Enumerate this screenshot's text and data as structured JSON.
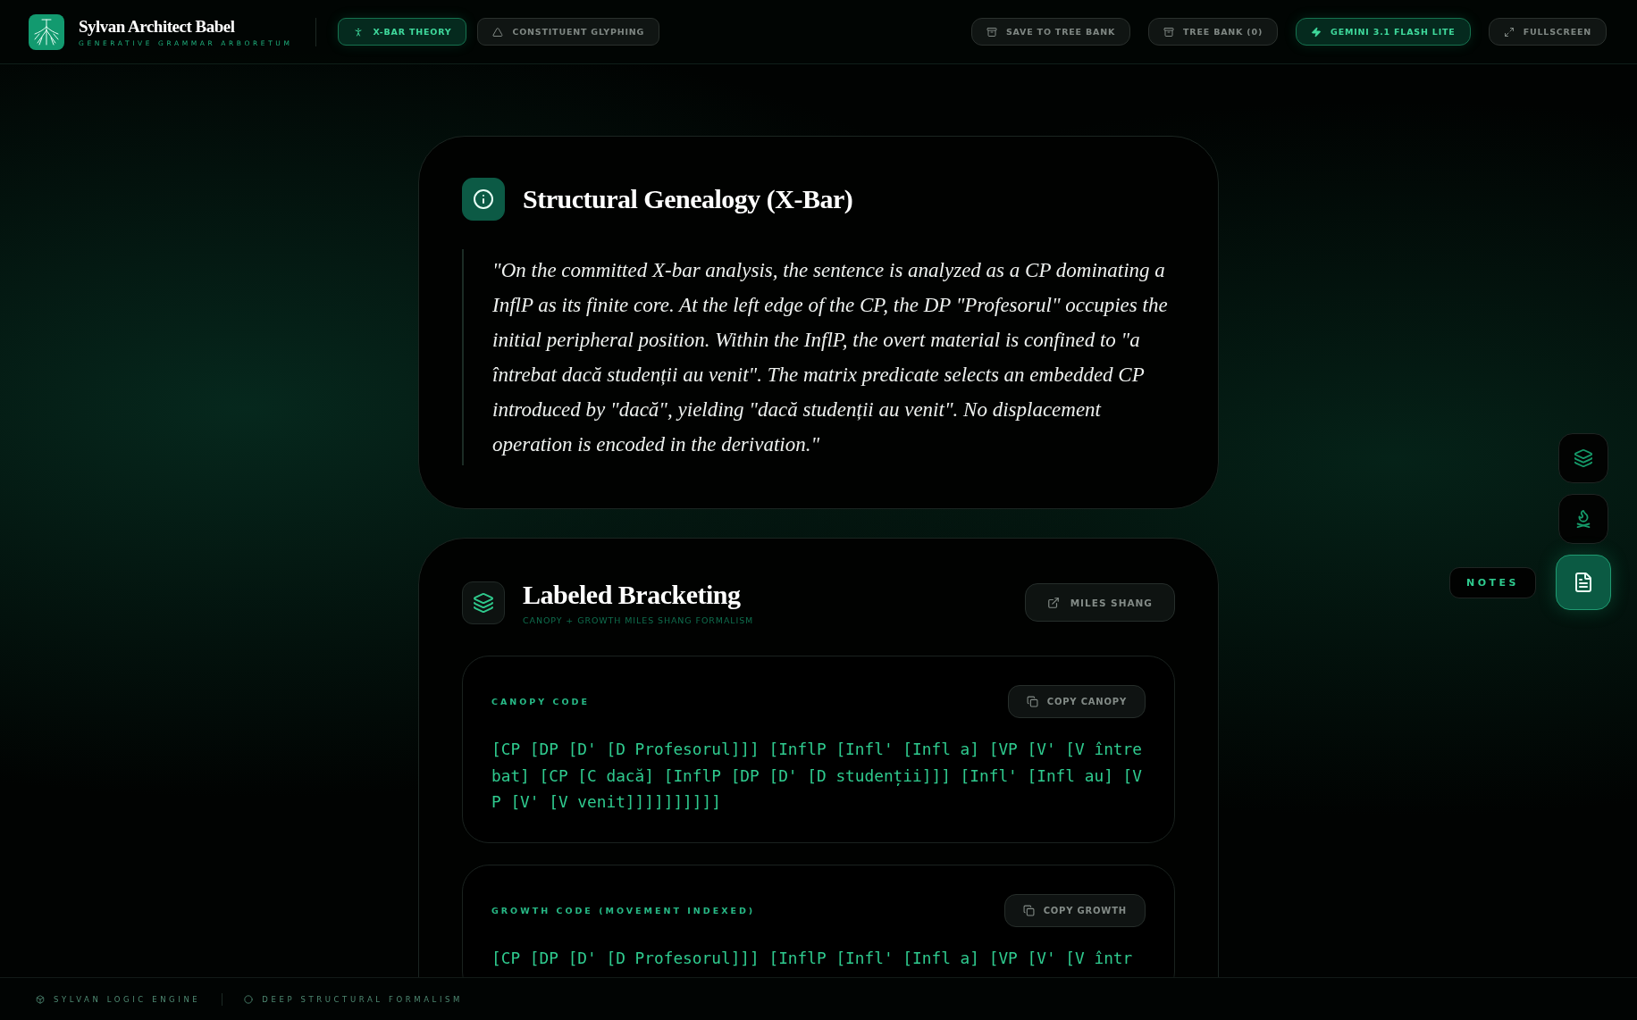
{
  "header": {
    "brand": {
      "title": "Sylvan Architect Babel",
      "subtitle": "GENERATIVE GRAMMAR ARBORETUM"
    },
    "mode_tabs": [
      {
        "label": "X-BAR THEORY",
        "kind": "figure",
        "selected": true
      },
      {
        "label": "CONSTITUENT GLYPHING",
        "kind": "triangle",
        "selected": false
      }
    ],
    "actions": [
      {
        "label": "SAVE TO TREE BANK",
        "kind": "archive",
        "highlighted": false
      },
      {
        "label": "TREE BANK (0)",
        "kind": "archive",
        "highlighted": false
      },
      {
        "label": "GEMINI 3.1 FLASH LITE",
        "kind": "bolt",
        "highlighted": true
      },
      {
        "label": "FULLSCREEN",
        "kind": "expand",
        "highlighted": false
      }
    ]
  },
  "genealogy_card": {
    "title": "Structural Genealogy (X-Bar)",
    "quote": "\"On the committed X-bar analysis, the sentence is analyzed as a CP dominating a InflP as its finite core. At the left edge of the CP, the DP \"Profesorul\" occupies the initial peripheral position. Within the InflP, the overt material is confined to \"a întrebat dacă studenții au venit\". The matrix predicate selects an embedded CP introduced by \"dacă\", yielding \"dacă studenții au venit\". No displacement operation is encoded in the derivation.\""
  },
  "bracketing_card": {
    "title": "Labeled Bracketing",
    "subtitle": "CANOPY + GROWTH MILES SHANG FORMALISM",
    "link_button": "MILES SHANG",
    "code_blocks": [
      {
        "label": "CANOPY CODE",
        "button": "COPY CANOPY",
        "code": "[CP [DP [D' [D Profesorul]]] [InflP [Infl' [Infl a] [VP [V' [V întrebat] [CP [C dacă] [InflP [DP [D' [D studenții]]] [Infl' [Infl au] [VP [V' [V venit]]]]]]]]]]"
      },
      {
        "label": "GROWTH CODE (MOVEMENT INDEXED)",
        "button": "COPY GROWTH",
        "code": "[CP [DP [D' [D Profesorul]]] [InflP [Infl' [Infl a] [VP [V' [V într"
      }
    ]
  },
  "side_rail": {
    "items": [
      {
        "kind": "layers",
        "selected": false
      },
      {
        "kind": "campfire",
        "selected": false
      },
      {
        "kind": "notes",
        "selected": true
      }
    ],
    "tooltip": "NOTES"
  },
  "footer": {
    "items": [
      {
        "label": "SYLVAN LOGIC ENGINE",
        "kind": "box"
      },
      {
        "label": "DEEP STRUCTURAL FORMALISM",
        "kind": "circle"
      }
    ]
  }
}
